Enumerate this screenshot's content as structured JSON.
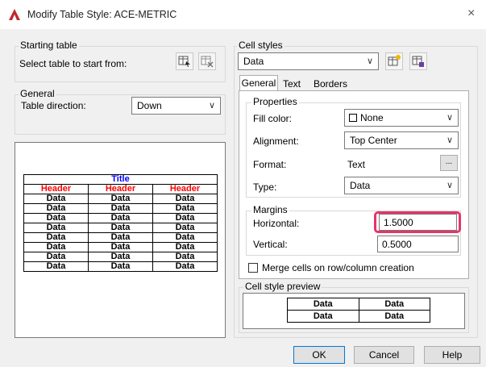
{
  "window": {
    "title": "Modify Table Style: ACE-METRIC",
    "close_glyph": "×"
  },
  "starting_table": {
    "group_label": "Starting table",
    "select_label": "Select table to start from:",
    "icons": [
      "select-table-icon",
      "remove-table-icon"
    ]
  },
  "general": {
    "group_label": "General",
    "direction_label": "Table direction:",
    "direction_value": "Down"
  },
  "preview": {
    "title": "Title",
    "headers": [
      "Header",
      "Header",
      "Header"
    ],
    "rows": [
      [
        "Data",
        "Data",
        "Data"
      ],
      [
        "Data",
        "Data",
        "Data"
      ],
      [
        "Data",
        "Data",
        "Data"
      ],
      [
        "Data",
        "Data",
        "Data"
      ],
      [
        "Data",
        "Data",
        "Data"
      ],
      [
        "Data",
        "Data",
        "Data"
      ],
      [
        "Data",
        "Data",
        "Data"
      ],
      [
        "Data",
        "Data",
        "Data"
      ]
    ],
    "title_color": "#0000ff",
    "header_color": "#ff0000"
  },
  "cell_styles": {
    "group_label": "Cell styles",
    "selected": "Data",
    "icons": [
      "new-cell-style-icon",
      "manage-cell-styles-icon"
    ]
  },
  "tabs": [
    {
      "label": "General",
      "active": true
    },
    {
      "label": "Text",
      "active": false
    },
    {
      "label": "Borders",
      "active": false
    }
  ],
  "properties": {
    "group_label": "Properties",
    "fill_color_label": "Fill color:",
    "fill_color_value": "None",
    "alignment_label": "Alignment:",
    "alignment_value": "Top Center",
    "format_label": "Format:",
    "format_value": "Text",
    "format_button": "...",
    "type_label": "Type:",
    "type_value": "Data"
  },
  "margins": {
    "group_label": "Margins",
    "horizontal_label": "Horizontal:",
    "horizontal_value": "1.5000",
    "vertical_label": "Vertical:",
    "vertical_value": "0.5000",
    "highlight_color": "#e8336b"
  },
  "merge": {
    "label": "Merge cells on row/column creation",
    "checked": false
  },
  "cell_style_preview": {
    "group_label": "Cell style preview",
    "rows": [
      [
        "Data",
        "Data"
      ],
      [
        "Data",
        "Data"
      ]
    ]
  },
  "buttons": {
    "ok": "OK",
    "cancel": "Cancel",
    "help": "Help"
  },
  "colors": {
    "accent": "#0078d7",
    "app_icon": "#c1272d"
  }
}
